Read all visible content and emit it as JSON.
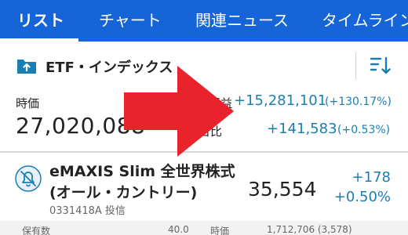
{
  "tabs": [
    {
      "label": "リスト",
      "active": true
    },
    {
      "label": "チャート",
      "active": false
    },
    {
      "label": "関連ニュース",
      "active": false
    },
    {
      "label": "タイムライン",
      "active": false
    }
  ],
  "group": {
    "title": "ETF・インデックス",
    "icon": "folder-upload-icon",
    "sort_icon": "sort-descending-icon"
  },
  "summary": {
    "price_label": "時価",
    "price_value": "27,020,088",
    "profit_label": "損益",
    "profit_value": "+15,281,101",
    "profit_pct": "(+130.17%)",
    "dod_label": "前日比",
    "dod_value": "+141,583",
    "dod_pct": "(+0.53%)"
  },
  "fund": {
    "name_line1": "eMAXIS Slim 全世界株式",
    "name_line2": "(オール・カントリー)",
    "code": "0331418A 投信",
    "price": "35,554",
    "change": "+178",
    "change_pct": "+0.50%",
    "icon": "bell-off-icon"
  },
  "bottom_partial": {
    "holdings_label": "保有数",
    "holdings_value": "40.0",
    "market_label": "時価",
    "market_value": "1,712,706 (3,578)"
  },
  "colors": {
    "tabbar": "#1565d8",
    "accent": "#1a7fb0",
    "overlay_arrow": "#e8232b"
  }
}
